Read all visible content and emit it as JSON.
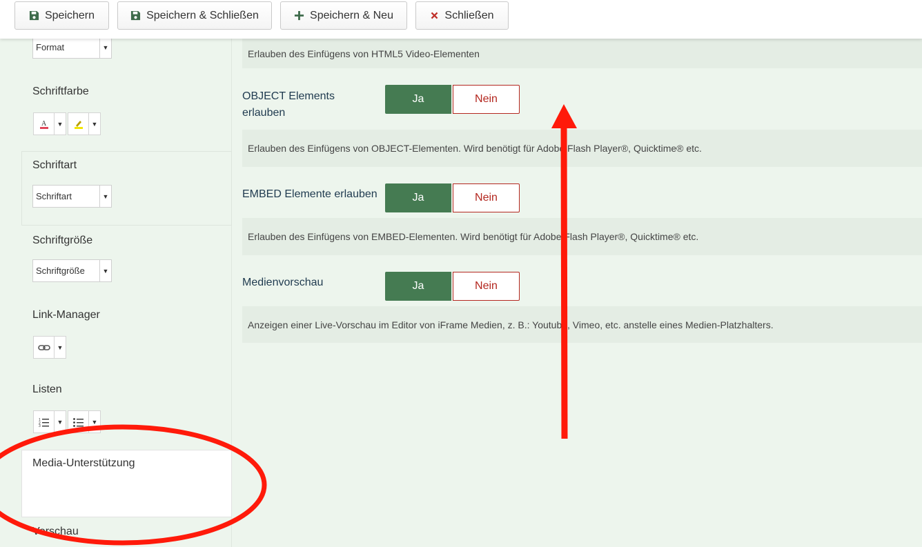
{
  "toolbar": {
    "save": "Speichern",
    "save_close": "Speichern & Schließen",
    "save_new": "Speichern & Neu",
    "close": "Schließen"
  },
  "sidebar": {
    "format_select": "Format",
    "font_color_label": "Schriftfarbe",
    "font_family_label": "Schriftart",
    "font_family_select": "Schriftart",
    "font_size_label": "Schriftgröße",
    "font_size_select": "Schriftgröße",
    "link_manager_label": "Link-Manager",
    "lists_label": "Listen",
    "media_support_label": "Media-Unterstützung",
    "preview_label": "Vorschau"
  },
  "options": {
    "html5_video_desc": "Erlauben des Einfügens von HTML5 Video-Elementen",
    "object": {
      "label": "OBJECT Elements erlauben",
      "yes": "Ja",
      "no": "Nein",
      "desc": "Erlauben des Einfügens von OBJECT-Elementen. Wird benötigt für Adobe Flash Player®, Quicktime® etc."
    },
    "embed": {
      "label": "EMBED Elemente erlauben",
      "yes": "Ja",
      "no": "Nein",
      "desc": "Erlauben des Einfügens von EMBED-Elementen. Wird benötigt für Adobe Flash Player®, Quicktime® etc."
    },
    "media_preview": {
      "label": "Medienvorschau",
      "yes": "Ja",
      "no": "Nein",
      "desc": "Anzeigen einer Live-Vorschau im Editor von iFrame Medien, z. B.: Youtube, Vimeo, etc. anstelle eines Medien-Platzhalters."
    }
  },
  "colors": {
    "accent_green": "#457b52",
    "danger_red": "#b3261e",
    "annotation_red": "#ff1a0a"
  }
}
